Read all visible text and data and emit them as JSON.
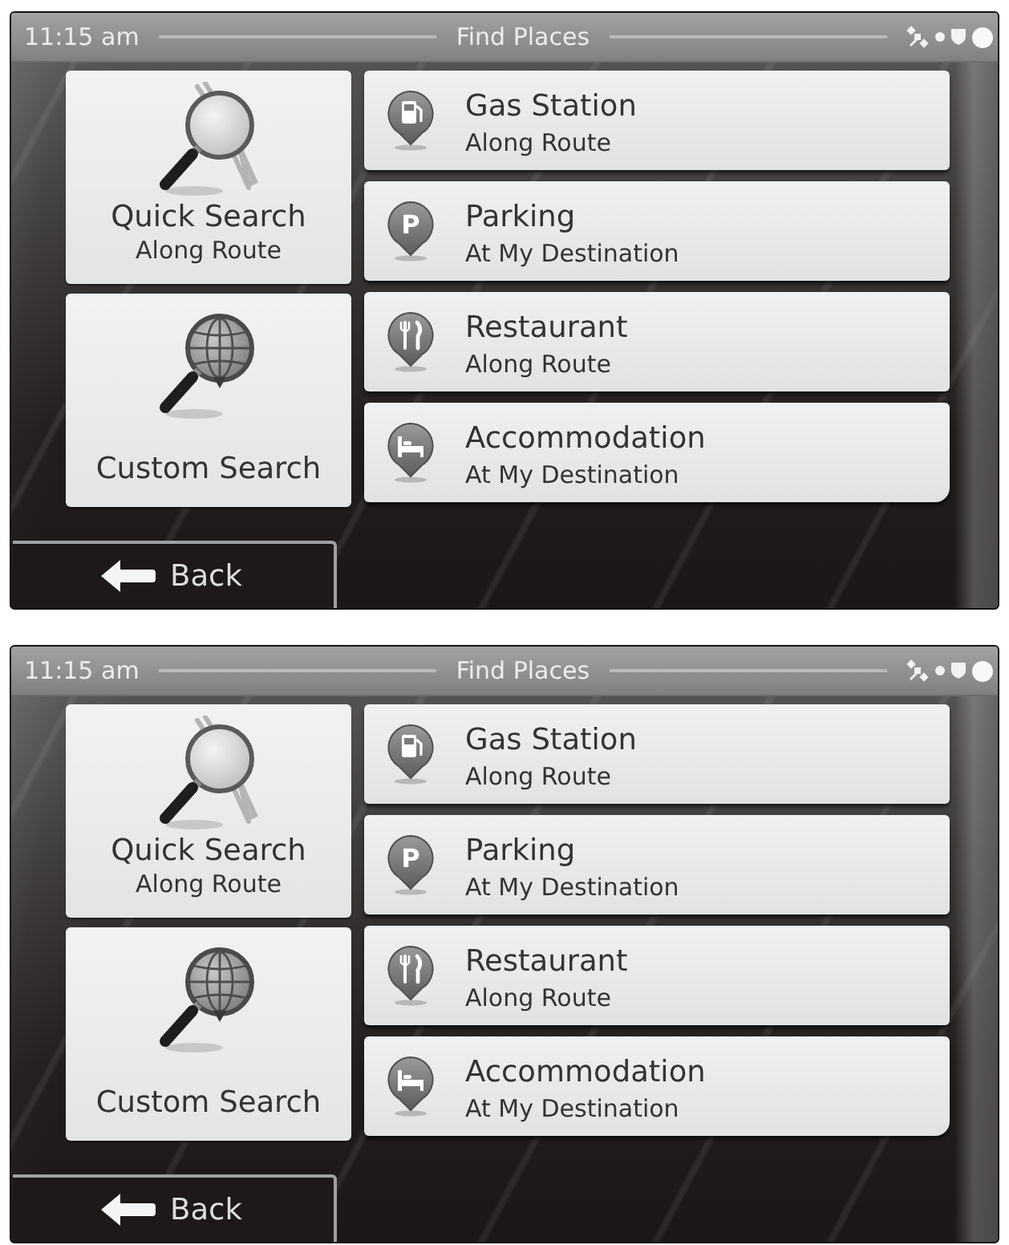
{
  "screens": [
    {
      "status_bar": {
        "time": "11:15 am",
        "title": "Find Places"
      },
      "search_buttons": [
        {
          "kind": "quick",
          "label": "Quick Search",
          "sublabel": "Along Route"
        },
        {
          "kind": "custom",
          "label": "Custom Search"
        }
      ],
      "categories": [
        {
          "kind": "fuel",
          "name": "Gas Station",
          "location": "Along Route"
        },
        {
          "kind": "parking",
          "name": "Parking",
          "location": "At My Destination",
          "icon_letter": "P"
        },
        {
          "kind": "restaurant",
          "name": "Restaurant",
          "location": "Along Route"
        },
        {
          "kind": "lodging",
          "name": "Accommodation",
          "location": "At My Destination"
        }
      ],
      "back_button": {
        "label": "Back"
      }
    },
    {
      "status_bar": {
        "time": "11:15 am",
        "title": "Find Places"
      },
      "search_buttons": [
        {
          "kind": "quick",
          "label": "Quick Search",
          "sublabel": "Along Route"
        },
        {
          "kind": "custom",
          "label": "Custom Search"
        }
      ],
      "categories": [
        {
          "kind": "fuel",
          "name": "Gas Station",
          "location": "Along Route"
        },
        {
          "kind": "parking",
          "name": "Parking",
          "location": "At My Destination",
          "icon_letter": "P"
        },
        {
          "kind": "restaurant",
          "name": "Restaurant",
          "location": "Along Route"
        },
        {
          "kind": "lodging",
          "name": "Accommodation",
          "location": "At My Destination"
        }
      ],
      "back_button": {
        "label": "Back"
      }
    }
  ]
}
